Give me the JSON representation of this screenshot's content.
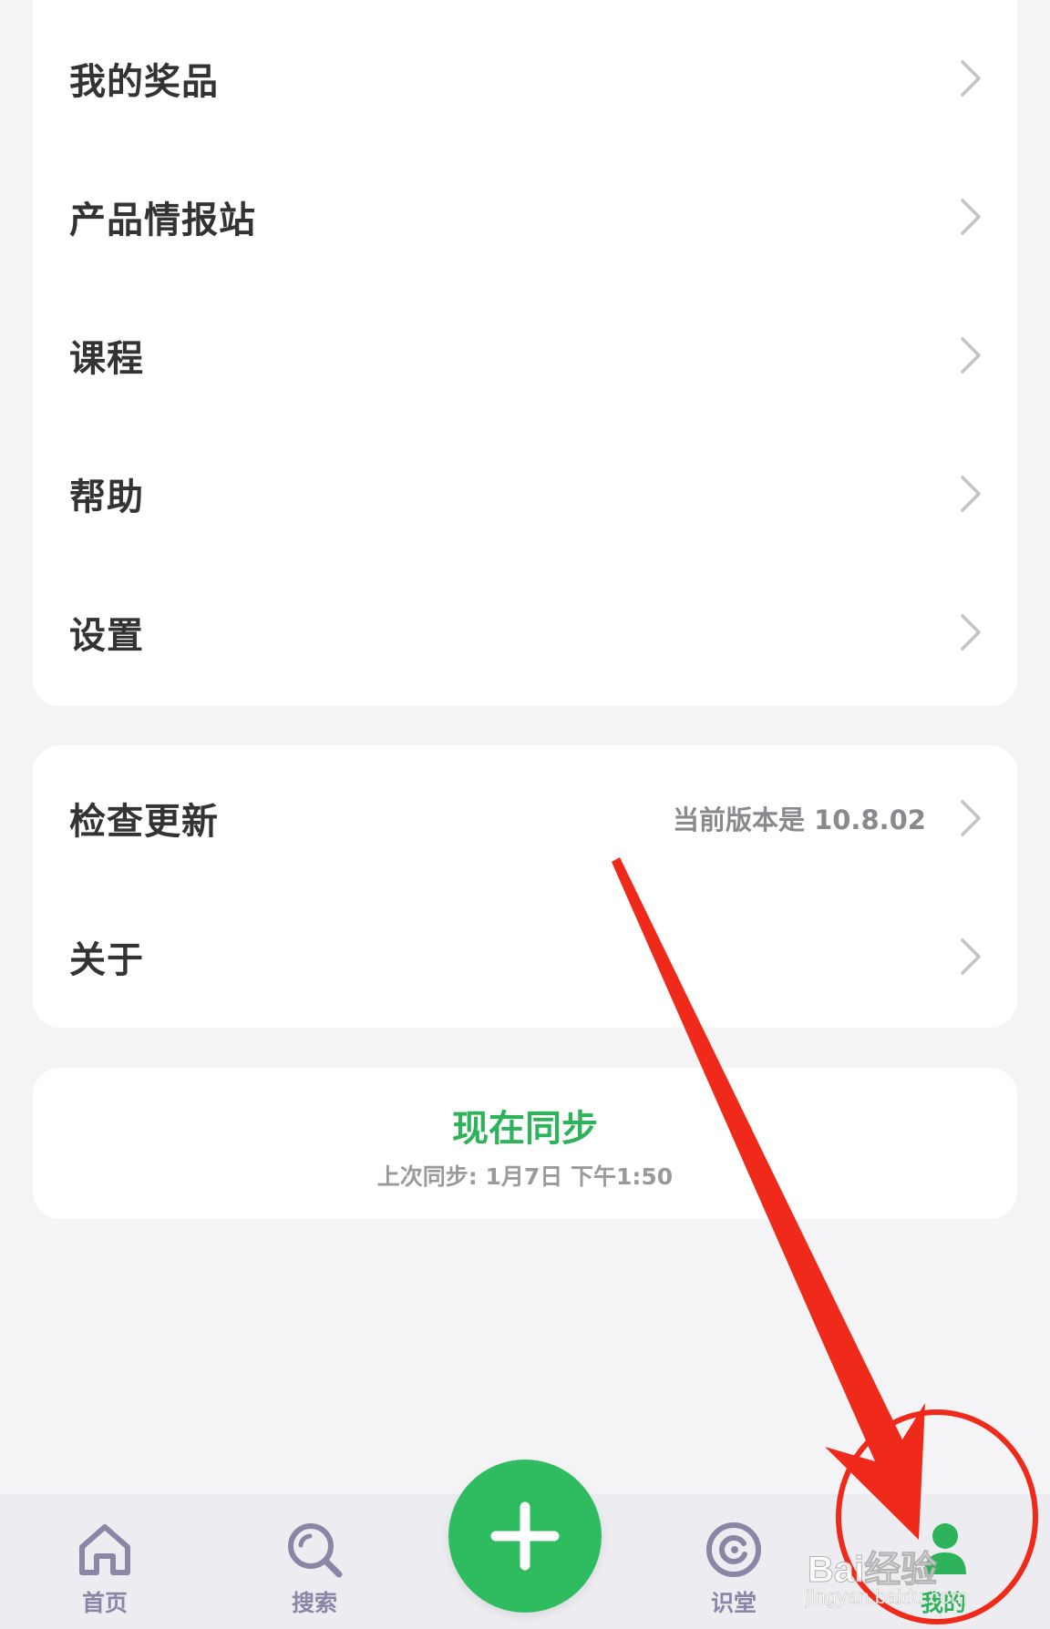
{
  "menu": {
    "items": [
      {
        "label": "我的奖品"
      },
      {
        "label": "产品情报站"
      },
      {
        "label": "课程"
      },
      {
        "label": "帮助"
      },
      {
        "label": "设置"
      }
    ]
  },
  "update_section": {
    "check_update_label": "检查更新",
    "version_text": "当前版本是 10.8.02",
    "about_label": "关于"
  },
  "sync": {
    "title": "现在同步",
    "last_sync": "上次同步: 1月7日 下午1:50"
  },
  "tabbar": {
    "tabs": [
      {
        "label": "首页",
        "icon": "home-icon"
      },
      {
        "label": "搜索",
        "icon": "search-icon"
      },
      {
        "label": "识堂",
        "icon": "learning-icon"
      },
      {
        "label": "我的",
        "icon": "user-icon",
        "active": true
      }
    ],
    "add_icon": "plus-icon"
  },
  "watermark": {
    "brand": "Bai经验",
    "url": "jingyan.baidu.com"
  },
  "colors": {
    "accent_green": "#2fb35a",
    "annotation_red": "#f02a1a",
    "tab_inactive": "#8a87a6"
  }
}
